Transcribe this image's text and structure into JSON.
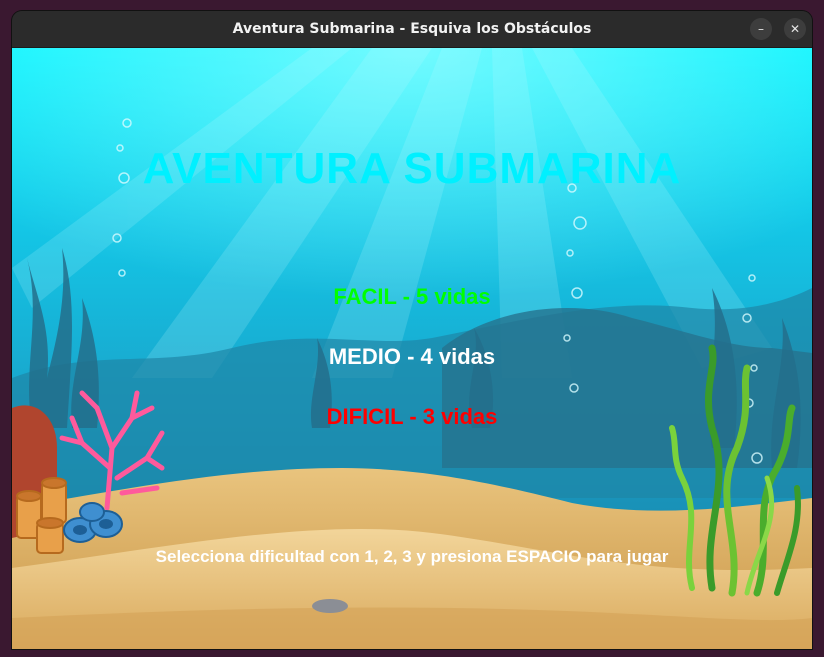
{
  "window": {
    "title": "Aventura Submarina - Esquiva los Obstáculos",
    "minimize_symbol": "–",
    "close_symbol": "✕"
  },
  "game": {
    "title": "AVENTURA SUBMARINA",
    "options": {
      "easy": "FACIL - 5 vidas",
      "medium": "MEDIO - 4 vidas",
      "hard": "DIFICIL - 3 vidas"
    },
    "selected_option": "easy",
    "instructions": "Selecciona dificultad con 1, 2, 3 y presiona ESPACIO para jugar"
  },
  "colors": {
    "title": "#00f0ff",
    "easy": "#00ff00",
    "medium": "#ffffff",
    "hard": "#ff0000",
    "water_top": "#00f0ff",
    "water_bottom": "#1a8fb8",
    "sand": "#e8c88a"
  }
}
